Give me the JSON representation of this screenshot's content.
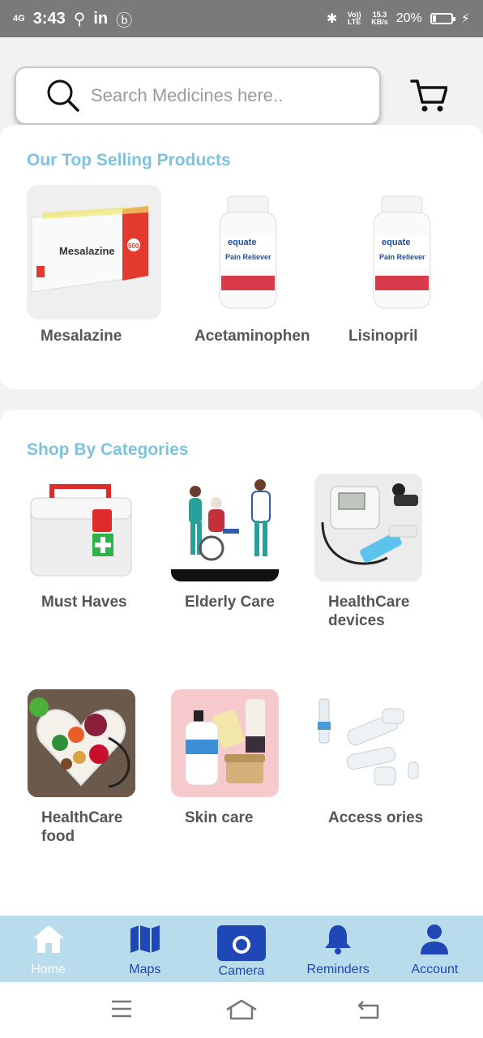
{
  "status_bar": {
    "network": "4G",
    "time": "3:43",
    "net_speed": "15.3",
    "net_unit": "KB/s",
    "volte": "Vo)) LTE",
    "battery": "20%",
    "battery_level": 0.2
  },
  "search": {
    "placeholder": "Search Medicines here.."
  },
  "top_selling": {
    "title": "Our Top Selling Products",
    "products": [
      {
        "name": "Mesalazine",
        "box_text": "Mesalazine",
        "badge": "500"
      },
      {
        "name": "Acetaminophen",
        "brand": "equate",
        "label": "Pain Reliever"
      },
      {
        "name": "Lisinopril",
        "brand": "equate",
        "label": "Pain Reliever"
      }
    ]
  },
  "categories": {
    "title": "Shop By Categories",
    "items": [
      {
        "name": "Must Haves"
      },
      {
        "name": "Elderly Care"
      },
      {
        "name": "HealthCare devices"
      },
      {
        "name": "HealthCare food"
      },
      {
        "name": "Skin care"
      },
      {
        "name": "Access ories"
      }
    ]
  },
  "bottom_nav": {
    "items": [
      {
        "label": "Home",
        "icon": "home-icon"
      },
      {
        "label": "Maps",
        "icon": "map-icon"
      },
      {
        "label": "Camera",
        "icon": "camera-icon"
      },
      {
        "label": "Reminders",
        "icon": "bell-icon"
      },
      {
        "label": "Account",
        "icon": "account-icon"
      }
    ]
  },
  "colors": {
    "accent": "#7ec3de",
    "nav_bg": "#b8dcec",
    "nav_icon": "#1f47b5"
  }
}
